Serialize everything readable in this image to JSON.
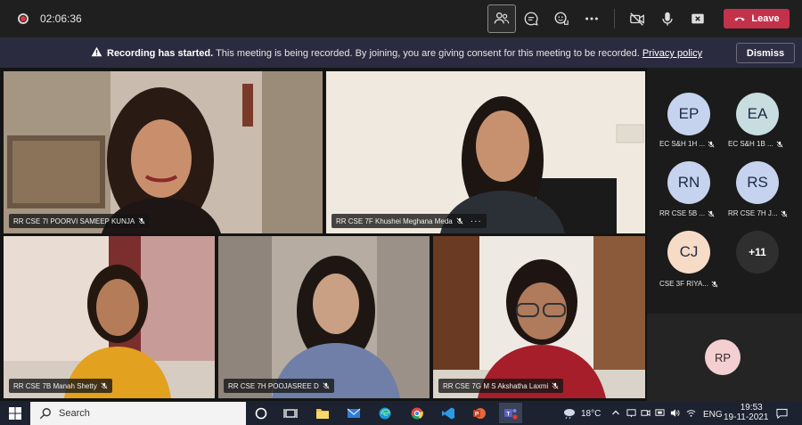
{
  "top_bar": {
    "timer": "02:06:36",
    "leave_label": "Leave"
  },
  "banner": {
    "title": "Recording has started.",
    "message": "This meeting is being recorded. By joining, you are giving consent for this meeting to be recorded.",
    "link": "Privacy policy",
    "dismiss": "Dismiss"
  },
  "tiles": [
    {
      "name": "RR CSE 7I POORVI SAMEEP KUNJA"
    },
    {
      "name": "RR CSE 7F Khushei Meghana Meda",
      "more": "···"
    },
    {
      "name": "RR CSE 7B Manah Shetty"
    },
    {
      "name": "RR CSE 7H POOJASREE D"
    },
    {
      "name": "RR CSE 7G M S Akshatha Laxmi"
    }
  ],
  "roster": [
    {
      "initials": "EP",
      "label": "EC S&H 1H ...",
      "color": "#c6d3ee"
    },
    {
      "initials": "EA",
      "label": "EC S&H 1B ...",
      "color": "#c7dde0"
    },
    {
      "initials": "RN",
      "label": "RR CSE 5B ...",
      "color": "#c6d3ee"
    },
    {
      "initials": "RS",
      "label": "RR CSE 7H J...",
      "color": "#c6d3ee"
    },
    {
      "initials": "CJ",
      "label": "CSE 3F RIYA...",
      "color": "#f6dcc6"
    }
  ],
  "overflow_count": "+11",
  "self_avatar": {
    "initials": "RP",
    "color": "#f3cfd1"
  },
  "taskbar": {
    "search_label": "Search",
    "temperature": "18°C",
    "language": "ENG",
    "time": "19:53",
    "date": "19-11-2021"
  }
}
